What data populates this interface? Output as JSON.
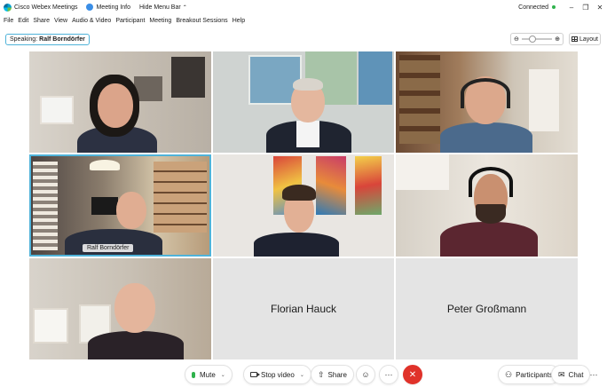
{
  "titlebar": {
    "app_title": "Cisco Webex Meetings",
    "meeting_info": "Meeting Info",
    "hide_menu_bar": "Hide Menu Bar",
    "status": "Connected",
    "status_color": "#2fb24c"
  },
  "menu": {
    "items": [
      "File",
      "Edit",
      "Share",
      "View",
      "Audio & Video",
      "Participant",
      "Meeting",
      "Breakout Sessions",
      "Help"
    ]
  },
  "speaking": {
    "prefix": "Speaking:",
    "name": "Ralf Borndörfer"
  },
  "layout_label": "Layout",
  "tiles": [
    {
      "name": "",
      "type": "video"
    },
    {
      "name": "",
      "type": "video"
    },
    {
      "name": "",
      "type": "video"
    },
    {
      "name": "Ralf Borndörfer",
      "type": "video",
      "active": true
    },
    {
      "name": "",
      "type": "video"
    },
    {
      "name": "",
      "type": "video"
    },
    {
      "name": "",
      "type": "video"
    },
    {
      "name": "Florian Hauck",
      "type": "no-video"
    },
    {
      "name": "Peter Großmann",
      "type": "no-video"
    }
  ],
  "controls": {
    "mute": "Mute",
    "stop_video": "Stop video",
    "share": "Share",
    "participants": "Participants",
    "chat": "Chat",
    "more": "···",
    "end_color": "#e0322a",
    "accent": "#4fb3d9"
  }
}
